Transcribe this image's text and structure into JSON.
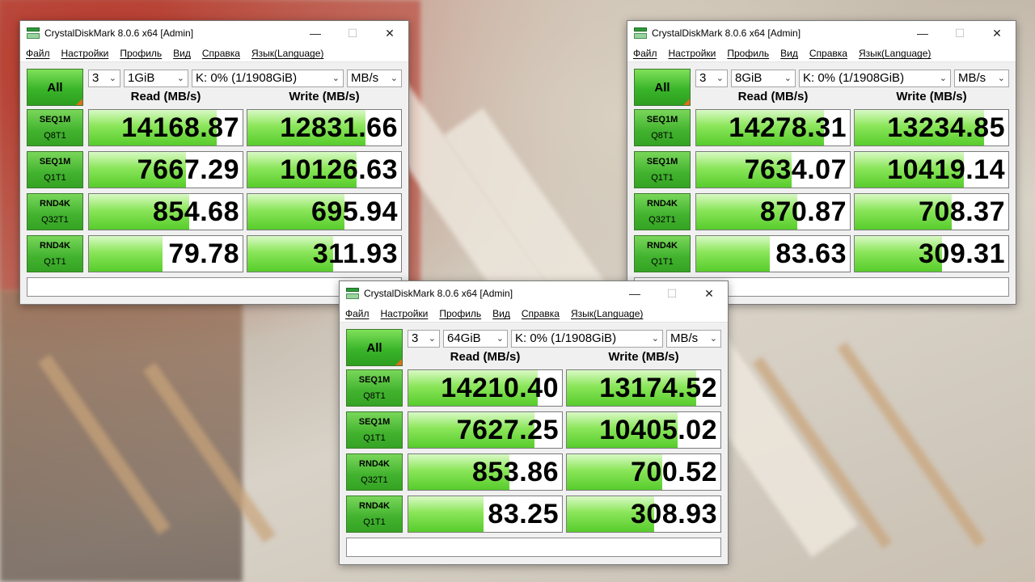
{
  "windows": [
    {
      "title": "CrystalDiskMark 8.0.6 x64 [Admin]",
      "menu": [
        "Файл",
        "Настройки",
        "Профиль",
        "Вид",
        "Справка",
        "Язык(Language)"
      ],
      "all_label": "All",
      "count": "3",
      "size": "1GiB",
      "drive": "K: 0% (1/1908GiB)",
      "unit": "MB/s",
      "read_header": "Read (MB/s)",
      "write_header": "Write (MB/s)",
      "rows": [
        {
          "line1": "SEQ1M",
          "line2": "Q8T1",
          "read": "14168.87",
          "write": "12831.66",
          "read_level": 0.83,
          "write_level": 0.77
        },
        {
          "line1": "SEQ1M",
          "line2": "Q1T1",
          "read": "7667.29",
          "write": "10126.63",
          "read_level": 0.63,
          "write_level": 0.71
        },
        {
          "line1": "RND4K",
          "line2": "Q32T1",
          "read": "854.68",
          "write": "695.94",
          "read_level": 0.65,
          "write_level": 0.63
        },
        {
          "line1": "RND4K",
          "line2": "Q1T1",
          "read": "79.78",
          "write": "311.93",
          "read_level": 0.48,
          "write_level": 0.56
        }
      ],
      "comment": ""
    },
    {
      "title": "CrystalDiskMark 8.0.6 x64 [Admin]",
      "menu": [
        "Файл",
        "Настройки",
        "Профиль",
        "Вид",
        "Справка",
        "Язык(Language)"
      ],
      "all_label": "All",
      "count": "3",
      "size": "8GiB",
      "drive": "K: 0% (1/1908GiB)",
      "unit": "MB/s",
      "read_header": "Read (MB/s)",
      "write_header": "Write (MB/s)",
      "rows": [
        {
          "line1": "SEQ1M",
          "line2": "Q8T1",
          "read": "14278.31",
          "write": "13234.85",
          "read_level": 0.83,
          "write_level": 0.84
        },
        {
          "line1": "SEQ1M",
          "line2": "Q1T1",
          "read": "7634.07",
          "write": "10419.14",
          "read_level": 0.62,
          "write_level": 0.71
        },
        {
          "line1": "RND4K",
          "line2": "Q32T1",
          "read": "870.87",
          "write": "708.37",
          "read_level": 0.66,
          "write_level": 0.63
        },
        {
          "line1": "RND4K",
          "line2": "Q1T1",
          "read": "83.63",
          "write": "309.31",
          "read_level": 0.48,
          "write_level": 0.57
        }
      ],
      "comment": ""
    },
    {
      "title": "CrystalDiskMark 8.0.6 x64 [Admin]",
      "menu": [
        "Файл",
        "Настройки",
        "Профиль",
        "Вид",
        "Справка",
        "Язык(Language)"
      ],
      "all_label": "All",
      "count": "3",
      "size": "64GiB",
      "drive": "K: 0% (1/1908GiB)",
      "unit": "MB/s",
      "read_header": "Read (MB/s)",
      "write_header": "Write (MB/s)",
      "rows": [
        {
          "line1": "SEQ1M",
          "line2": "Q8T1",
          "read": "14210.40",
          "write": "13174.52",
          "read_level": 0.84,
          "write_level": 0.84
        },
        {
          "line1": "SEQ1M",
          "line2": "Q1T1",
          "read": "7627.25",
          "write": "10405.02",
          "read_level": 0.82,
          "write_level": 0.72
        },
        {
          "line1": "RND4K",
          "line2": "Q32T1",
          "read": "853.86",
          "write": "700.52",
          "read_level": 0.66,
          "write_level": 0.62
        },
        {
          "line1": "RND4K",
          "line2": "Q1T1",
          "read": "83.25",
          "write": "308.93",
          "read_level": 0.49,
          "write_level": 0.57
        }
      ],
      "comment": ""
    }
  ]
}
